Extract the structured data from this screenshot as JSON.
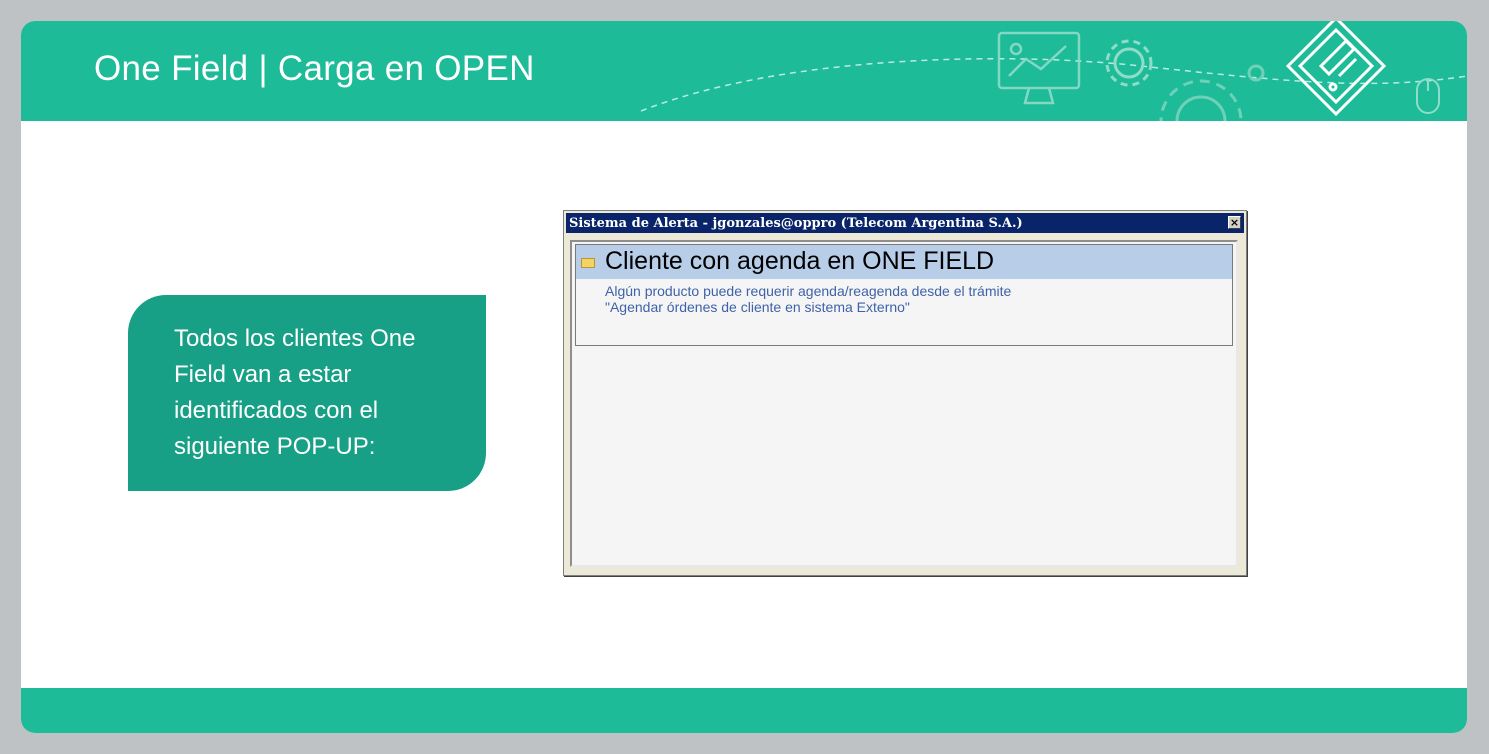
{
  "slide": {
    "title": "One Field | Carga en OPEN",
    "accent_color": "#1dbb98",
    "callout_color": "#17a086"
  },
  "callout": {
    "text": "Todos los clientes One Field van a estar identificados con el siguiente POP-UP:"
  },
  "popup": {
    "window_title": "Sistema de Alerta - jgonzales@oppro (Telecom Argentina S.A.)",
    "close_label": "×",
    "alert": {
      "icon": "envelope-icon",
      "title": "Cliente con agenda en ONE FIELD",
      "description": "Algún producto puede requerir agenda/reagenda desde el trámite\n\"Agendar órdenes de cliente en sistema Externo\""
    }
  },
  "decorations": [
    "monitor-chart-icon",
    "gear-icon",
    "large-gear-icon",
    "pen-document-icon",
    "mouse-icon"
  ]
}
